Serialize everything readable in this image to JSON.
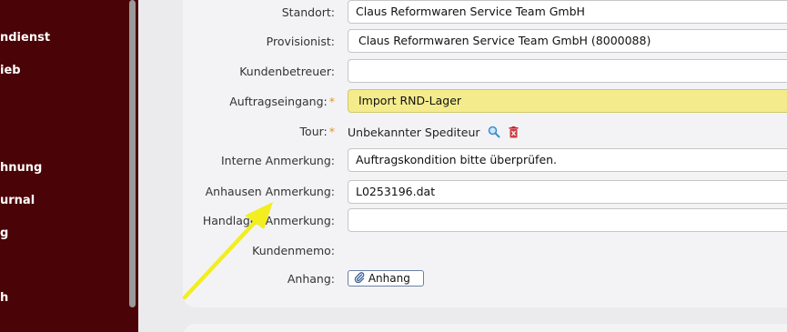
{
  "sidebar": {
    "items": [
      {
        "label": "ndienst"
      },
      {
        "label": "ieb"
      },
      {
        "label": "hnung"
      },
      {
        "label": "urnal"
      },
      {
        "label": "g"
      },
      {
        "label": "h"
      }
    ]
  },
  "form": {
    "standort": {
      "label": "Standort:",
      "value": "Claus Reformwaren Service Team GmbH"
    },
    "provisionist": {
      "label": "Provisionist:",
      "value": "Claus Reformwaren Service Team GmbH (8000088)"
    },
    "kundenbetreuer": {
      "label": "Kundenbetreuer:",
      "value": ""
    },
    "auftragseingang": {
      "label": "Auftragseingang:",
      "required_mark": "*",
      "value": "Import RND-Lager"
    },
    "tour": {
      "label": "Tour:",
      "required_mark": "*",
      "value": "Unbekannter Spediteur"
    },
    "interne_anmerkung": {
      "label": "Interne Anmerkung:",
      "value": "Auftragskondition bitte überprüfen."
    },
    "anhausen_anmerkung": {
      "label": "Anhausen Anmerkung:",
      "value": "L0253196.dat"
    },
    "handlager_anmerkung": {
      "label": "Handlager Anmerkung:",
      "value": ""
    },
    "kundenmemo": {
      "label": "Kundenmemo:"
    },
    "anhang": {
      "label": "Anhang:",
      "button_label": "Anhang"
    }
  },
  "colors": {
    "sidebar_bg": "#4a0306",
    "required": "#e8921f",
    "highlight_field": "#f4ec8c",
    "annotation_arrow": "#f2ee1f"
  },
  "icons": [
    "search-icon",
    "delete-icon",
    "paperclip-icon"
  ]
}
